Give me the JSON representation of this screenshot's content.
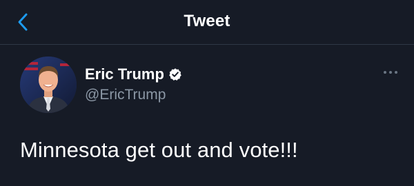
{
  "nav": {
    "title": "Tweet",
    "back_icon": "chevron-left-icon",
    "accent_color": "#1d9bf0"
  },
  "author": {
    "display_name": "Eric Trump",
    "handle": "@EricTrump",
    "verified": true,
    "verified_icon": "verified-badge-icon"
  },
  "tweet": {
    "text": "Minnesota get out and vote!!!"
  },
  "actions": {
    "more_icon": "more-horizontal-icon"
  },
  "colors": {
    "background": "#161b26",
    "secondary_text": "#8b97a5",
    "divider": "#2f3846"
  }
}
